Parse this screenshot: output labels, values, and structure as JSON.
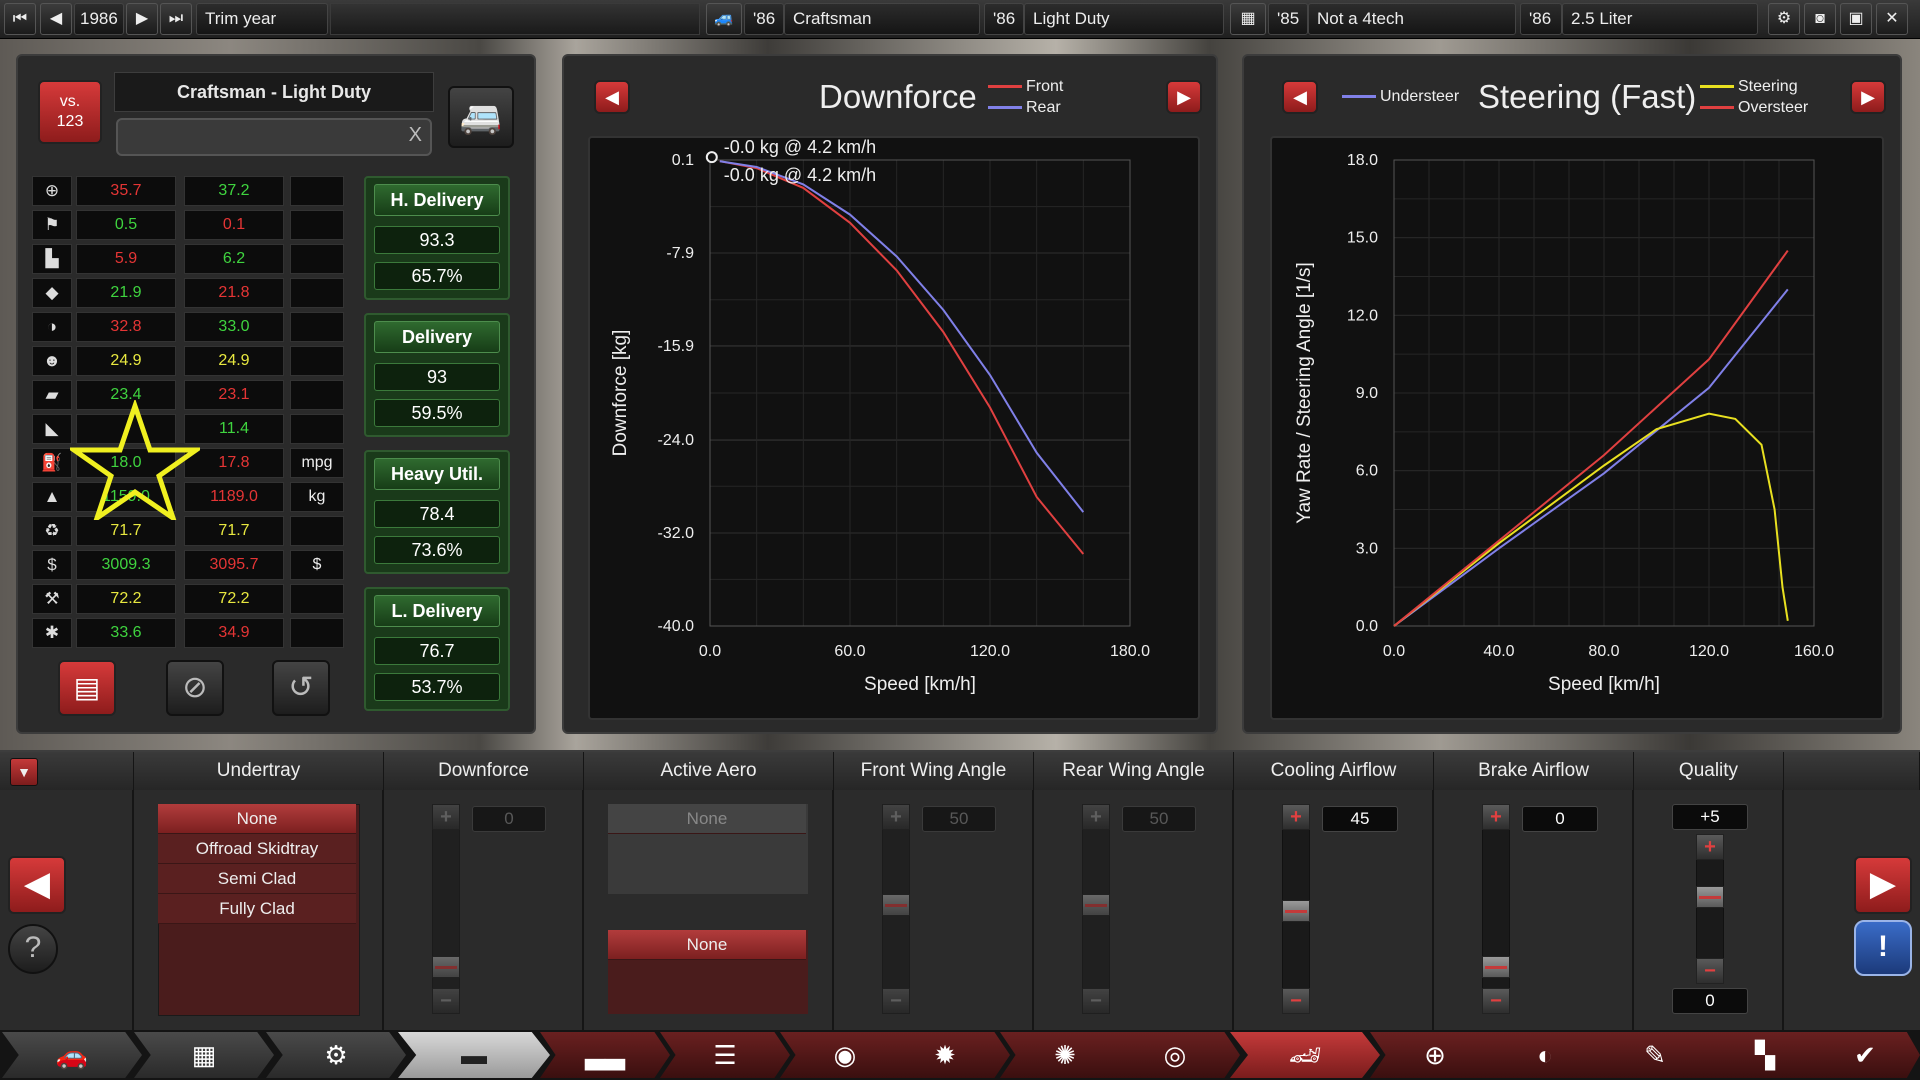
{
  "topbar": {
    "year": "1986",
    "trim_year_label": "Trim year",
    "model_year": "'86",
    "model_name": "Craftsman",
    "trim_year": "'86",
    "trim_name": "Light Duty",
    "engine_year": "'85",
    "engine_name": "Not a 4tech",
    "variant_year": "'86",
    "variant_name": "2.5 Liter"
  },
  "left": {
    "vs_label": "vs.",
    "vs_number": "123",
    "car_title": "Craftsman - Light Duty",
    "search_clear": "X",
    "stats": [
      {
        "icon": "steering-wheel-icon",
        "a": "35.7",
        "a_color": "red",
        "b": "37.2",
        "b_color": "green",
        "unit": ""
      },
      {
        "icon": "race-flag-icon",
        "a": "0.5",
        "a_color": "green",
        "b": "0.1",
        "b_color": "red",
        "unit": ""
      },
      {
        "icon": "seat-icon",
        "a": "5.9",
        "a_color": "red",
        "b": "6.2",
        "b_color": "green",
        "unit": ""
      },
      {
        "icon": "diamond-icon",
        "a": "21.9",
        "a_color": "green",
        "b": "21.8",
        "b_color": "red",
        "unit": ""
      },
      {
        "icon": "safety-icon",
        "a": "32.8",
        "a_color": "red",
        "b": "33.0",
        "b_color": "green",
        "unit": ""
      },
      {
        "icon": "passengers-icon",
        "a": "24.9",
        "a_color": "yellow",
        "b": "24.9",
        "b_color": "yellow",
        "unit": ""
      },
      {
        "icon": "cargo-truck-icon",
        "a": "23.4",
        "a_color": "green",
        "b": "23.1",
        "b_color": "red",
        "unit": ""
      },
      {
        "icon": "offroad-icon",
        "a": "",
        "a_color": "green",
        "b": "11.4",
        "b_color": "green",
        "unit": ""
      },
      {
        "icon": "fuel-can-icon",
        "a": "18.0",
        "a_color": "green",
        "b": "17.8",
        "b_color": "red",
        "unit": "mpg"
      },
      {
        "icon": "weight-icon",
        "a": "1159.0",
        "a_color": "green",
        "b": "1189.0",
        "b_color": "red",
        "unit": "kg"
      },
      {
        "icon": "environment-icon",
        "a": "71.7",
        "a_color": "yellow",
        "b": "71.7",
        "b_color": "yellow",
        "unit": ""
      },
      {
        "icon": "price-icon",
        "a": "3009.3",
        "a_color": "green",
        "b": "3095.7",
        "b_color": "red",
        "unit": "$"
      },
      {
        "icon": "engineering-icon",
        "a": "72.2",
        "a_color": "yellow",
        "b": "72.2",
        "b_color": "yellow",
        "unit": ""
      },
      {
        "icon": "service-icon",
        "a": "33.6",
        "a_color": "green",
        "b": "34.9",
        "b_color": "red",
        "unit": ""
      }
    ],
    "demographics": [
      {
        "name": "H. Delivery",
        "score": "93.3",
        "pct": "65.7%"
      },
      {
        "name": "Delivery",
        "score": "93",
        "pct": "59.5%"
      },
      {
        "name": "Heavy Util.",
        "score": "78.4",
        "pct": "73.6%"
      },
      {
        "name": "L. Delivery",
        "score": "76.7",
        "pct": "53.7%"
      }
    ]
  },
  "downforce_chart": {
    "title": "Downforce",
    "legend": [
      "Front",
      "Rear"
    ],
    "tooltip_front": "-0.0 kg @ 4.2 km/h",
    "tooltip_rear": "-0.0 kg @ 4.2 km/h",
    "xlabel": "Speed [km/h]",
    "ylabel": "Downforce [kg]",
    "yticks": [
      "0.1",
      "-7.9",
      "-15.9",
      "-24.0",
      "-32.0",
      "-40.0"
    ],
    "xticks": [
      "0.0",
      "60.0",
      "120.0",
      "180.0"
    ]
  },
  "steering_chart": {
    "title": "Steering (Fast)",
    "legend_left": "Understeer",
    "legend_right": [
      "Steering",
      "Oversteer"
    ],
    "xlabel": "Speed [km/h]",
    "ylabel": "Yaw Rate / Steering Angle [1/s]",
    "yticks": [
      "18.0",
      "15.0",
      "12.0",
      "9.0",
      "6.0",
      "3.0",
      "0.0"
    ],
    "xticks": [
      "0.0",
      "40.0",
      "80.0",
      "120.0",
      "160.0"
    ]
  },
  "chart_data": [
    {
      "type": "line",
      "title": "Downforce",
      "xlabel": "Speed [km/h]",
      "ylabel": "Downforce [kg]",
      "xlim": [
        0,
        180
      ],
      "ylim": [
        -40.0,
        0.1
      ],
      "series": [
        {
          "name": "Front",
          "color": "#e04040",
          "x": [
            4.2,
            20,
            40,
            60,
            80,
            100,
            120,
            140,
            160
          ],
          "y": [
            0.0,
            -0.6,
            -2.3,
            -5.3,
            -9.4,
            -14.7,
            -21.2,
            -28.9,
            -33.8
          ]
        },
        {
          "name": "Rear",
          "color": "#8080e8",
          "x": [
            4.2,
            20,
            40,
            60,
            80,
            100,
            120,
            140,
            160
          ],
          "y": [
            0.0,
            -0.5,
            -2.0,
            -4.6,
            -8.2,
            -12.8,
            -18.4,
            -25.1,
            -30.2
          ]
        }
      ]
    },
    {
      "type": "line",
      "title": "Steering (Fast)",
      "xlabel": "Speed [km/h]",
      "ylabel": "Yaw Rate / Steering Angle [1/s]",
      "xlim": [
        0,
        160
      ],
      "ylim": [
        0,
        18
      ],
      "series": [
        {
          "name": "Understeer",
          "color": "#8080e8",
          "x": [
            0,
            40,
            80,
            120,
            150
          ],
          "y": [
            0,
            3.0,
            5.9,
            9.2,
            13.0
          ]
        },
        {
          "name": "Steering",
          "color": "#e8e020",
          "x": [
            0,
            40,
            80,
            100,
            120,
            130,
            140,
            145,
            148,
            150
          ],
          "y": [
            0,
            3.2,
            6.2,
            7.6,
            8.2,
            8.0,
            7.0,
            4.5,
            1.5,
            0.2
          ]
        },
        {
          "name": "Oversteer",
          "color": "#e04040",
          "x": [
            0,
            40,
            80,
            120,
            150
          ],
          "y": [
            0,
            3.3,
            6.6,
            10.3,
            14.5
          ]
        }
      ]
    }
  ],
  "bottom": {
    "columns": [
      "Undertray",
      "Downforce",
      "Active Aero",
      "Front Wing Angle",
      "Rear Wing Angle",
      "Cooling Airflow",
      "Brake Airflow",
      "Quality"
    ],
    "undertray_options": [
      "None",
      "Offroad Skidtray",
      "Semi Clad",
      "Fully Clad"
    ],
    "downforce_value": "0",
    "active_aero_top": "None",
    "active_aero_selected": "None",
    "front_wing_value": "50",
    "rear_wing_value": "50",
    "cooling_value": "45",
    "brake_value": "0",
    "quality_top": "+5",
    "quality_bottom": "0",
    "help_label": "?",
    "warning_label": "!"
  },
  "colors": {
    "accent_red": "#c43a3a",
    "positive": "#3fd43f",
    "negative": "#e53535",
    "neutral": "#e8e840"
  }
}
